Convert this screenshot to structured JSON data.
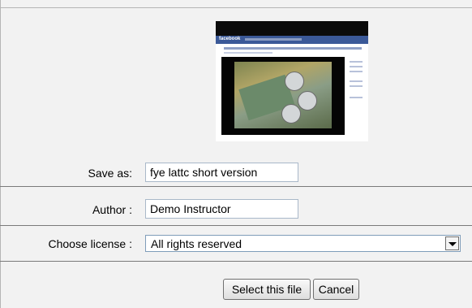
{
  "preview": {
    "logo_text": "facebook"
  },
  "form": {
    "save_as_label": "Save as:",
    "save_as_value": "fye lattc short version",
    "author_label": "Author :",
    "author_value": "Demo Instructor",
    "license_label": "Choose license :",
    "license_selected": "All rights reserved"
  },
  "buttons": {
    "select_label": "Select this file",
    "cancel_label": "Cancel"
  },
  "icons": {
    "dropdown": "chevron-down-icon"
  }
}
